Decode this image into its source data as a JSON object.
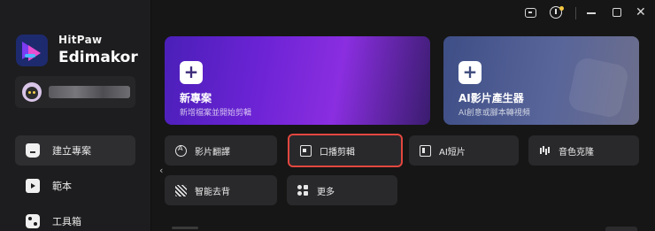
{
  "app": {
    "brand_line1": "HitPaw",
    "brand_line2": "Edimakor"
  },
  "sidebar": {
    "items": [
      {
        "label": "建立專案",
        "icon": "home-icon",
        "active": true
      },
      {
        "label": "範本",
        "icon": "template-icon",
        "active": false
      },
      {
        "label": "工具箱",
        "icon": "toolbox-icon",
        "active": false
      }
    ]
  },
  "hero": {
    "new_project": {
      "title": "新專案",
      "subtitle": "新增檔案並開始剪輯"
    },
    "ai_video": {
      "title": "AI影片產生器",
      "subtitle": "AI創意或腳本轉視頻"
    }
  },
  "tools": [
    {
      "label": "影片翻譯",
      "icon": "translate-icon"
    },
    {
      "label": "口播剪輯",
      "icon": "talking-head-icon",
      "highlighted": true
    },
    {
      "label": "AI短片",
      "icon": "ai-shorts-icon"
    },
    {
      "label": "音色克隆",
      "icon": "voice-clone-icon"
    },
    {
      "label": "智能去背",
      "icon": "background-remove-icon"
    },
    {
      "label": "更多",
      "icon": "more-icon"
    }
  ],
  "colors": {
    "highlight": "#e2473f",
    "hero_new": "#6b23d4",
    "hero_ai": "#58659a"
  }
}
